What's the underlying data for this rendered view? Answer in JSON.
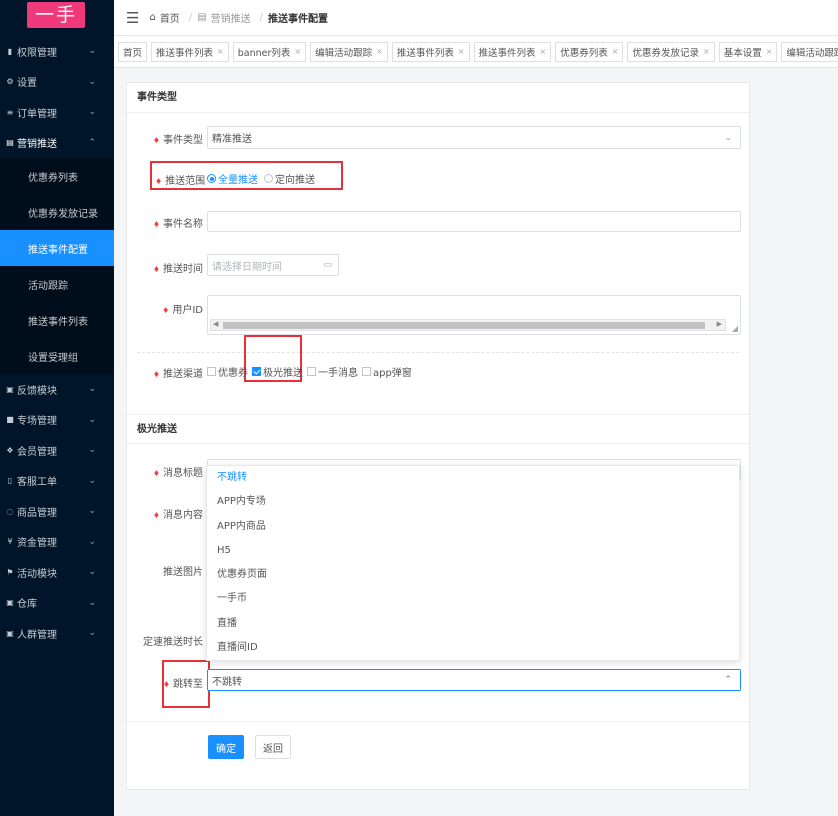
{
  "app": {
    "logo": "一手"
  },
  "sidebar": {
    "items": [
      {
        "label": "权限管理",
        "icon": "lock-icon",
        "chevron": "⌄"
      },
      {
        "label": "设置",
        "icon": "gear-icon",
        "chevron": "⌄"
      },
      {
        "label": "订单管理",
        "icon": "list-icon",
        "chevron": "⌄"
      },
      {
        "label": "营销推送",
        "icon": "calendar-icon",
        "chevron": "⌃",
        "open": true,
        "children": [
          "优惠券列表",
          "优惠券发放记录",
          "推送事件配置",
          "活动跟踪",
          "推送事件列表",
          "设置受理组"
        ],
        "active": "推送事件配置"
      },
      {
        "label": "反馈模块",
        "icon": "feedback-icon",
        "chevron": "⌄"
      },
      {
        "label": "专场管理",
        "icon": "square-icon",
        "chevron": "⌄"
      },
      {
        "label": "会员管理",
        "icon": "member-icon",
        "chevron": "⌄"
      },
      {
        "label": "客服工单",
        "icon": "ticket-icon",
        "chevron": "⌄"
      },
      {
        "label": "商品管理",
        "icon": "bag-icon",
        "chevron": "⌄"
      },
      {
        "label": "资金管理",
        "icon": "yen-icon",
        "chevron": "⌄"
      },
      {
        "label": "活动模块",
        "icon": "flag-icon",
        "chevron": "⌄"
      },
      {
        "label": "仓库",
        "icon": "warehouse-icon",
        "chevron": "⌄"
      },
      {
        "label": "人群管理",
        "icon": "people-icon",
        "chevron": "⌄"
      }
    ]
  },
  "topbar": {
    "breadcrumb": [
      "首页",
      "营销推送",
      "推送事件配置"
    ],
    "separator": "/"
  },
  "tabs": [
    {
      "label": "首页",
      "closable": false
    },
    {
      "label": "推送事件列表",
      "closable": true
    },
    {
      "label": "banner列表",
      "closable": true
    },
    {
      "label": "编辑活动跟踪",
      "closable": true
    },
    {
      "label": "推送事件列表",
      "closable": true
    },
    {
      "label": "推送事件列表",
      "closable": true
    },
    {
      "label": "优惠券列表",
      "closable": true
    },
    {
      "label": "优惠券发放记录",
      "closable": true
    },
    {
      "label": "基本设置",
      "closable": true
    },
    {
      "label": "编辑活动跟踪",
      "closable": true
    }
  ],
  "form": {
    "section1": "事件类型",
    "event_type": {
      "label": "事件类型",
      "value": "精准推送"
    },
    "push_scope": {
      "label": "推送范围",
      "options": [
        "全量推送",
        "定向推送"
      ],
      "selected": "全量推送"
    },
    "event_name": {
      "label": "事件名称",
      "value": ""
    },
    "push_time": {
      "label": "推送时间",
      "placeholder": "请选择日期时间"
    },
    "user_id": {
      "label": "用户ID",
      "value": ""
    },
    "channel": {
      "label": "推送渠道",
      "options": [
        {
          "label": "优惠券",
          "checked": false
        },
        {
          "label": "极光推送",
          "checked": true
        },
        {
          "label": "一手消息",
          "checked": false
        },
        {
          "label": "app弹窗",
          "checked": false
        }
      ]
    },
    "section2": "极光推送",
    "msg_title": {
      "label": "消息标题"
    },
    "msg_content": {
      "label": "消息内容"
    },
    "push_image": {
      "label": "推送图片"
    },
    "rate_duration": {
      "label": "定速推送时长"
    },
    "jump_to": {
      "label": "跳转至",
      "value": "不跳转",
      "options": [
        "不跳转",
        "APP内专场",
        "APP内商品",
        "H5",
        "优惠券页面",
        "一手币",
        "直播",
        "直播间ID"
      ],
      "selected": "不跳转"
    },
    "buttons": {
      "confirm": "确定",
      "back": "返回"
    }
  },
  "colors": {
    "accent": "#1890ff",
    "logo": "#f0397a",
    "highlight": "#e8303a",
    "sidebar": "#001529"
  }
}
